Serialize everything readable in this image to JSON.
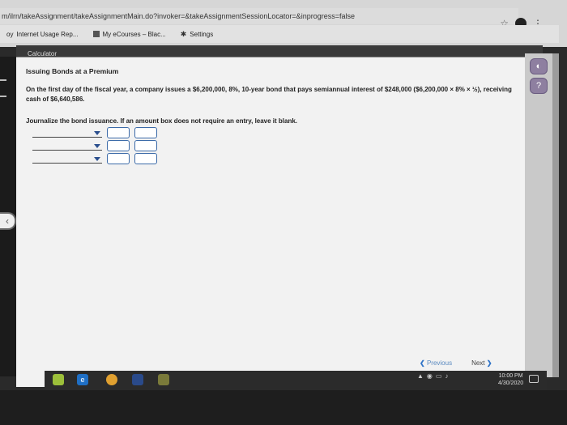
{
  "browser": {
    "url": "m/ilrn/takeAssignment/takeAssignmentMain.do?invoker=&takeAssignmentSessionLocator=&inprogress=false",
    "bookmarks": [
      {
        "label": "Internet Usage Rep...",
        "prefix": "oy"
      },
      {
        "label": "My eCourses – Blac..."
      },
      {
        "label": "Settings"
      }
    ]
  },
  "app": {
    "calculator_label": "Calculator",
    "heading": "Issuing Bonds at a Premium",
    "paragraph": "On the first day of the fiscal year, a company issues a $6,200,000, 8%, 10-year bond that pays semiannual interest of $248,000 ($6,200,000 × 8% × ½), receiving cash of $6,640,586.",
    "instruction": "Journalize the bond issuance. If an amount box does not require an entry, leave it blank.",
    "nav": {
      "previous": "Previous",
      "next": "Next"
    }
  },
  "taskbar": {
    "clock_time": "10:00 PM",
    "clock_date": "4/30/2020"
  },
  "colors": {
    "accent": "#3b6aa8",
    "side_icon": "#8e7fa0"
  }
}
